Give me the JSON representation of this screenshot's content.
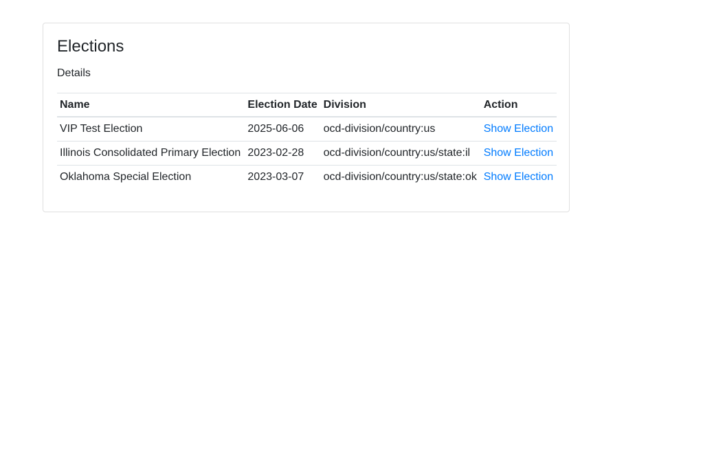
{
  "card": {
    "title": "Elections",
    "subtitle": "Details"
  },
  "table": {
    "headers": {
      "name": "Name",
      "date": "Election Date",
      "division": "Division",
      "action": "Action"
    },
    "rows": [
      {
        "name": "VIP Test Election",
        "date": "2025-06-06",
        "division": "ocd-division/country:us",
        "action": "Show Election"
      },
      {
        "name": "Illinois Consolidated Primary Election",
        "date": "2023-02-28",
        "division": "ocd-division/country:us/state:il",
        "action": "Show Election"
      },
      {
        "name": "Oklahoma Special Election",
        "date": "2023-03-07",
        "division": "ocd-division/country:us/state:ok",
        "action": "Show Election"
      }
    ]
  },
  "colors": {
    "link": "#007bff",
    "text": "#212529",
    "border": "#dee2e6"
  }
}
